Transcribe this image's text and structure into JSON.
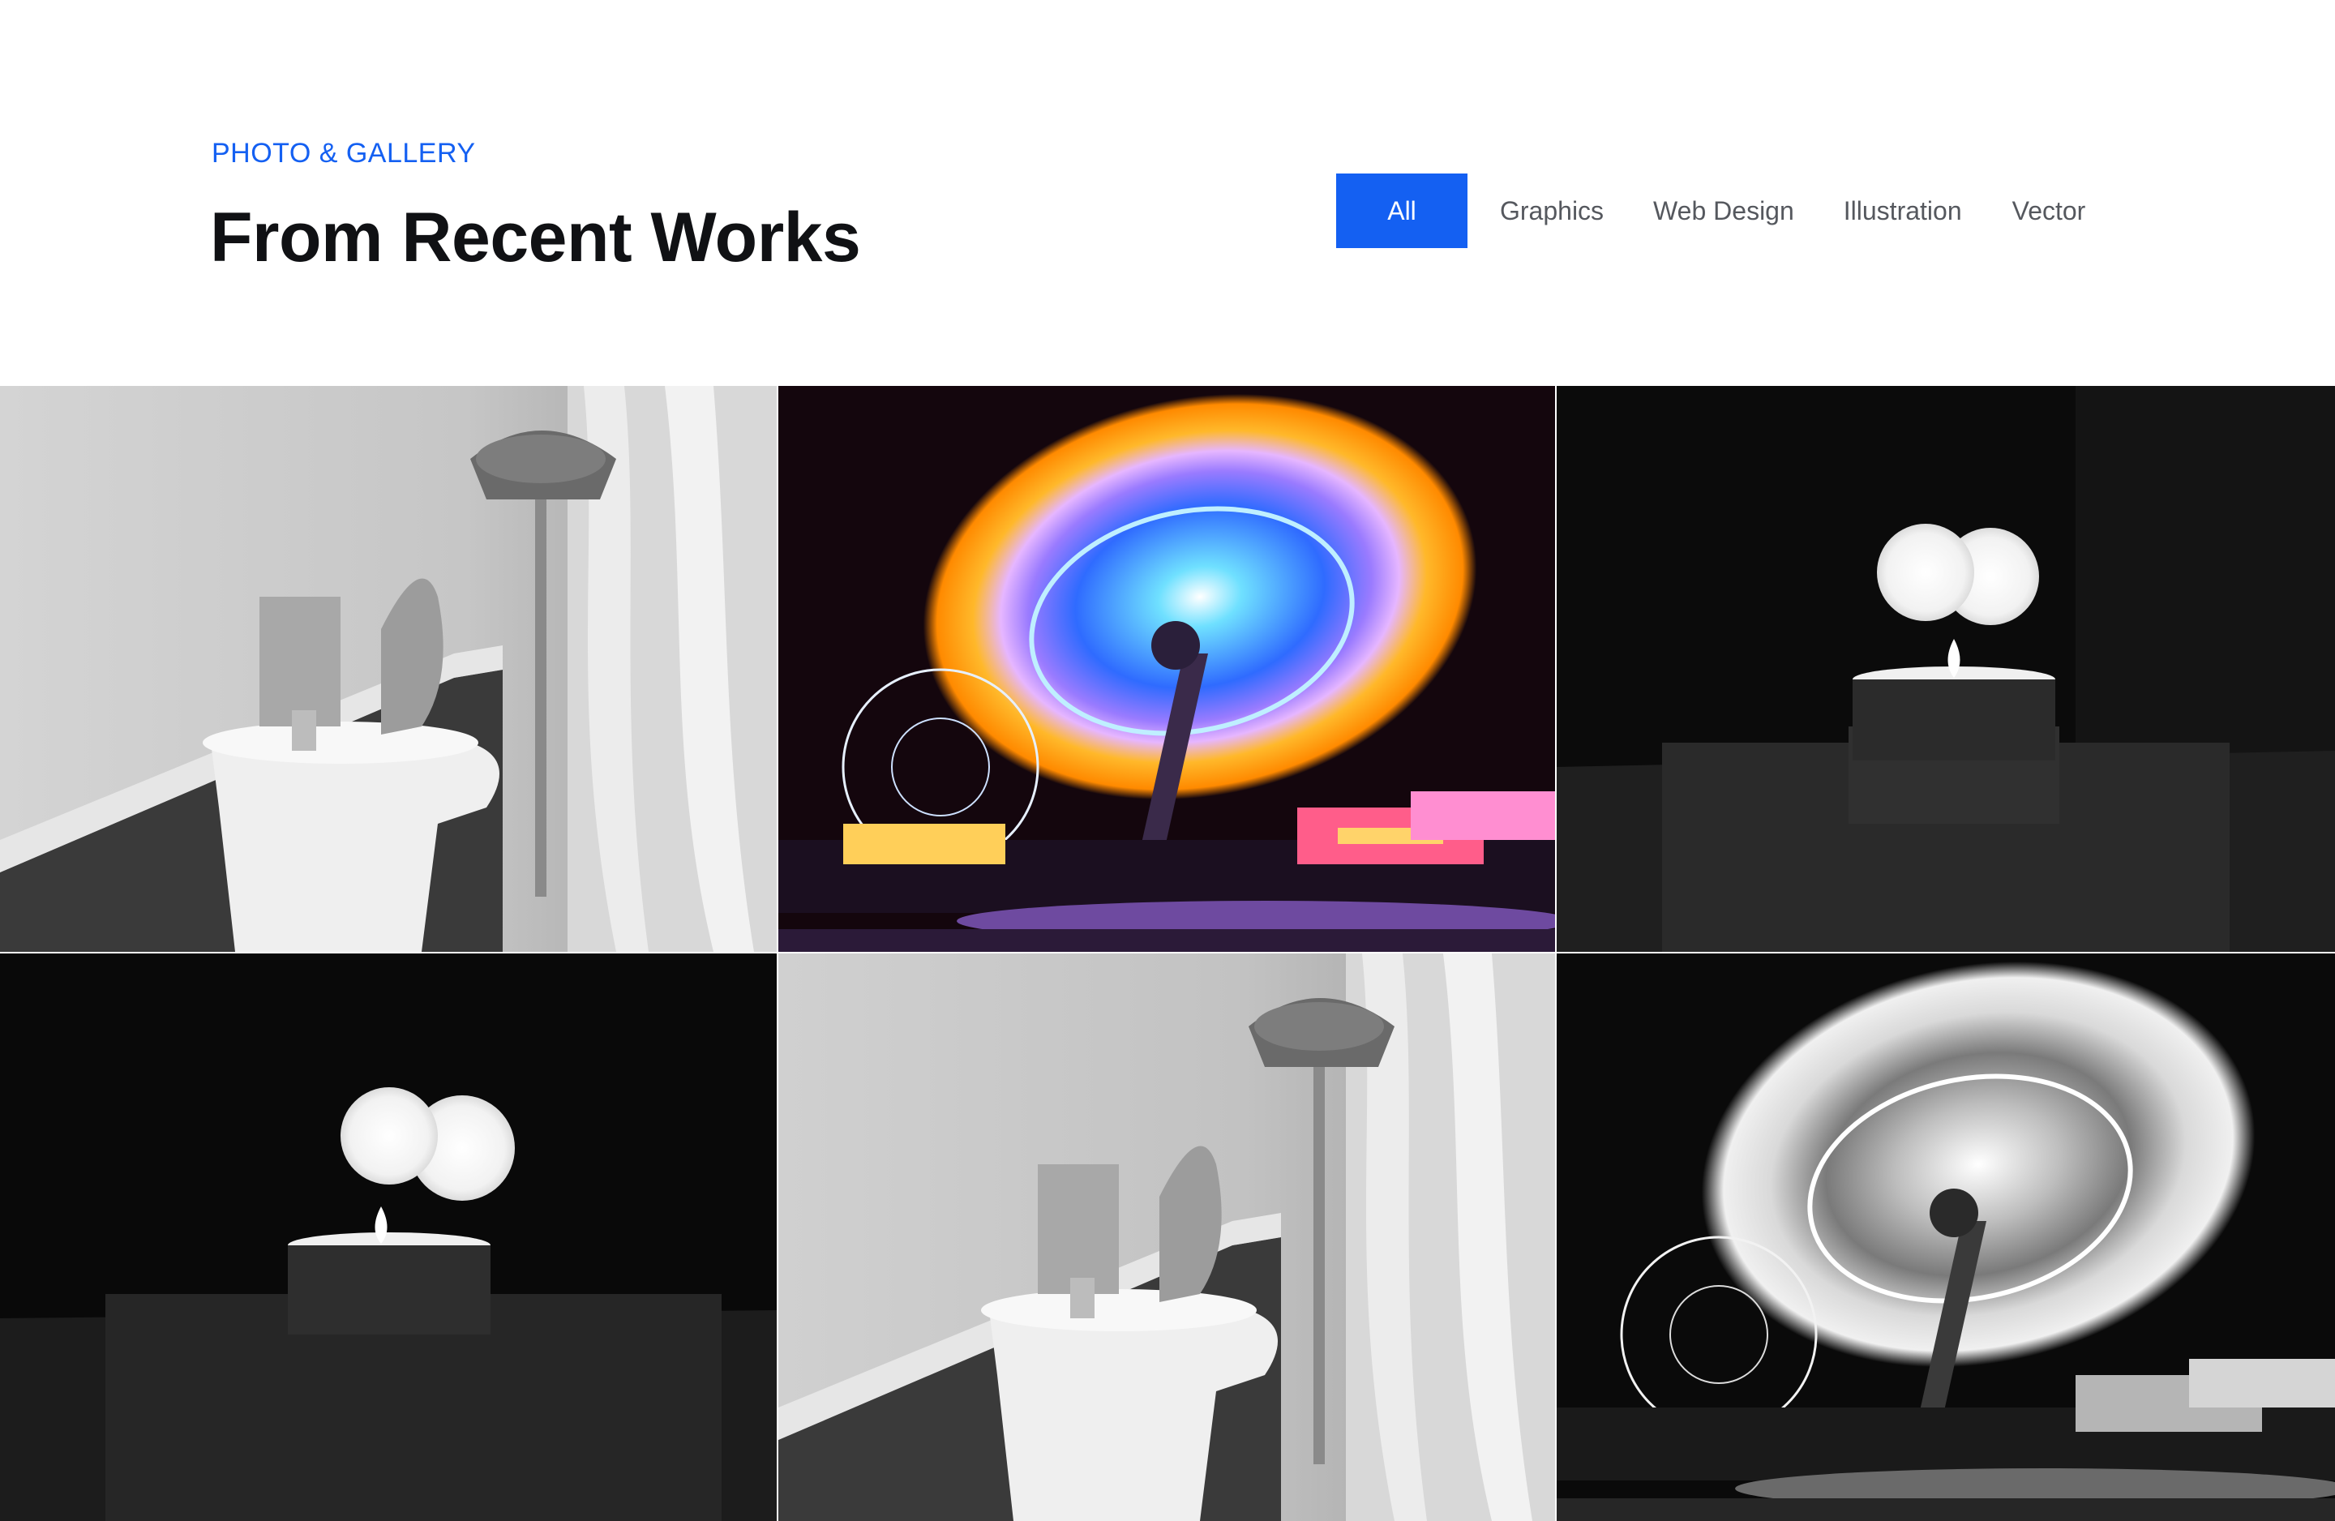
{
  "header": {
    "eyebrow": "PHOTO & GALLERY",
    "title": "From Recent Works"
  },
  "filters": [
    {
      "label": "All",
      "active": true
    },
    {
      "label": "Graphics",
      "active": false
    },
    {
      "label": "Web Design",
      "active": false
    },
    {
      "label": "Illustration",
      "active": false
    },
    {
      "label": "Vector",
      "active": false
    }
  ],
  "colors": {
    "accent": "#1460f2",
    "title": "#101114",
    "filter_text": "#55585e"
  },
  "gallery": {
    "items": [
      {
        "subject": "dresser-lamp",
        "tone": "grayscale"
      },
      {
        "subject": "carnival-ride",
        "tone": "color"
      },
      {
        "subject": "tealight-candle",
        "tone": "grayscale"
      },
      {
        "subject": "tealight-candle",
        "tone": "grayscale"
      },
      {
        "subject": "dresser-lamp",
        "tone": "grayscale"
      },
      {
        "subject": "carnival-ride",
        "tone": "grayscale"
      }
    ]
  }
}
